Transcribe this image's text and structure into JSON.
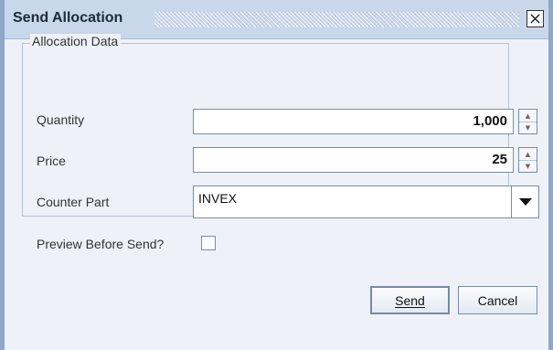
{
  "window": {
    "title": "Send Allocation",
    "close_icon": "close-x-icon"
  },
  "group": {
    "legend": "Allocation Data"
  },
  "quantity": {
    "label": "Quantity",
    "value": "1,000"
  },
  "price": {
    "label": "Price",
    "value": "25"
  },
  "counterpart": {
    "label": "Counter Part",
    "selected": "INVEX"
  },
  "preview": {
    "label": "Preview Before Send?",
    "checked": false
  },
  "buttons": {
    "send": "Send",
    "cancel": "Cancel"
  },
  "colors": {
    "frame": "#8fa8c9",
    "titlebar": "#c9d7ea",
    "background": "#eef2f8"
  }
}
